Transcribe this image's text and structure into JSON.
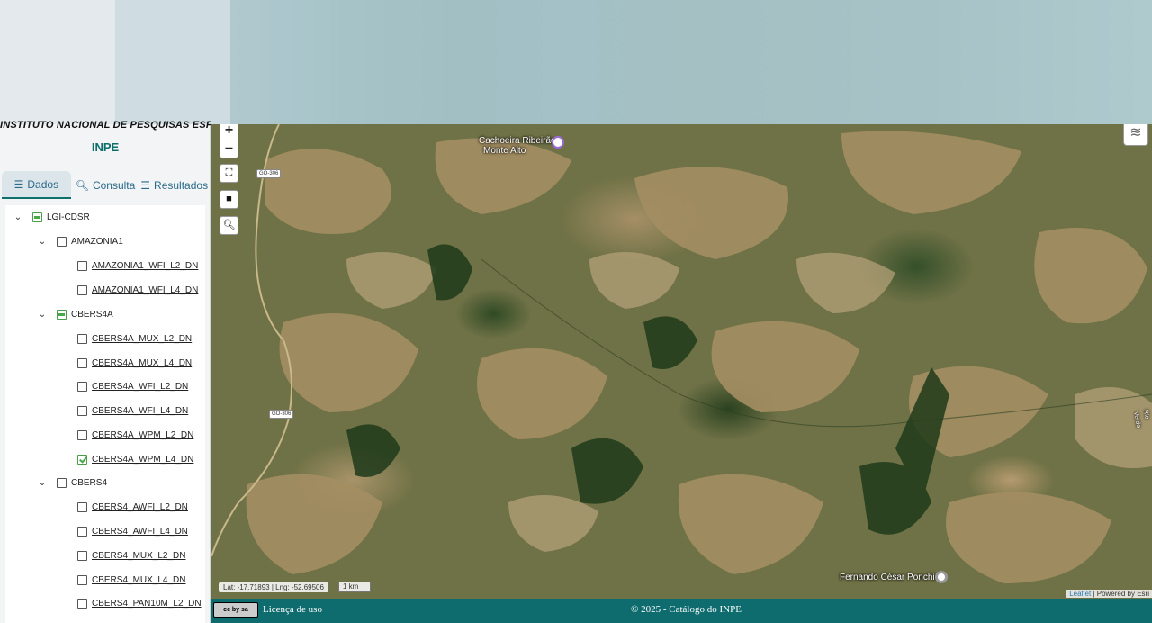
{
  "header": {
    "institute": "INSTITUTO NACIONAL DE PESQUISAS ESPACIAIS",
    "acronym": "INPE"
  },
  "tabs": [
    {
      "label": "Dados",
      "icon": "list-icon",
      "active": true
    },
    {
      "label": "Consulta",
      "icon": "search-icon",
      "active": false
    },
    {
      "label": "Resultados",
      "icon": "list-icon",
      "active": false
    }
  ],
  "tree": {
    "root": {
      "label": "LGI-CDSR",
      "state": "partial"
    },
    "groups": [
      {
        "label": "AMAZONIA1",
        "state": "unchecked",
        "items": [
          {
            "label": "AMAZONIA1_WFI_L2_DN",
            "checked": false
          },
          {
            "label": "AMAZONIA1_WFI_L4_DN",
            "checked": false
          }
        ]
      },
      {
        "label": "CBERS4A",
        "state": "partial",
        "items": [
          {
            "label": "CBERS4A_MUX_L2_DN",
            "checked": false
          },
          {
            "label": "CBERS4A_MUX_L4_DN",
            "checked": false
          },
          {
            "label": "CBERS4A_WFI_L2_DN",
            "checked": false
          },
          {
            "label": "CBERS4A_WFI_L4_DN",
            "checked": false
          },
          {
            "label": "CBERS4A_WPM_L2_DN",
            "checked": false
          },
          {
            "label": "CBERS4A_WPM_L4_DN",
            "checked": true
          }
        ]
      },
      {
        "label": "CBERS4",
        "state": "unchecked",
        "items": [
          {
            "label": "CBERS4_AWFI_L2_DN",
            "checked": false
          },
          {
            "label": "CBERS4_AWFI_L4_DN",
            "checked": false
          },
          {
            "label": "CBERS4_MUX_L2_DN",
            "checked": false
          },
          {
            "label": "CBERS4_MUX_L4_DN",
            "checked": false
          },
          {
            "label": "CBERS4_PAN10M_L2_DN",
            "checked": false
          }
        ]
      }
    ]
  },
  "map": {
    "zoom_in": "+",
    "zoom_out": "−",
    "places": {
      "place1_line1": "Cachoeira Ribeirão",
      "place1_line2": "Monte Alto",
      "place2": "Fernando César Ponchio",
      "river": "Rio Verde"
    },
    "road_labels": [
      "GO-306",
      "GO-306"
    ],
    "coords": "Lat: -17.71893 | Lng: -52.69506",
    "scale": "1 km",
    "attribution_link": "Leaflet",
    "attribution_text": " | Powered by Esri"
  },
  "footer": {
    "license": "Licença de uso",
    "copyright": "© 2025 - Catálogo do INPE",
    "cc_badge": "cc by sa"
  },
  "colors": {
    "teal": "#0e6b6e",
    "check_green": "#4aa84a"
  }
}
